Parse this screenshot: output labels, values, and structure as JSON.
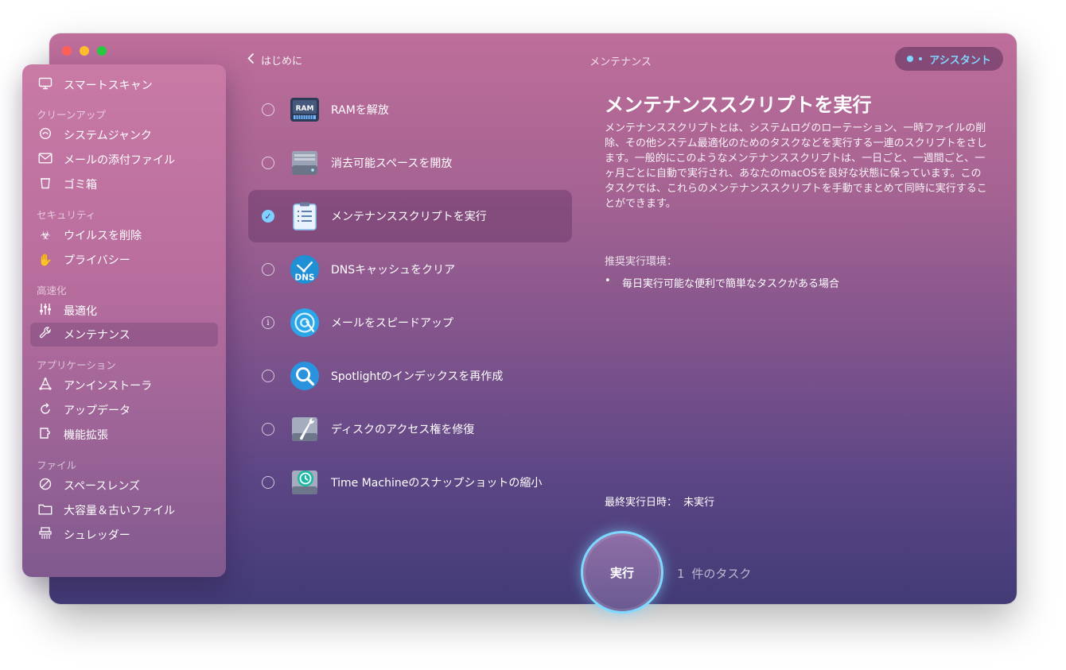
{
  "sidebar": {
    "smart_scan": "スマートスキャン",
    "sections": {
      "cleanup": "クリーンアップ",
      "security": "セキュリティ",
      "speed": "高速化",
      "applications": "アプリケーション",
      "files": "ファイル"
    },
    "items": {
      "system_junk": "システムジャンク",
      "mail_attachments": "メールの添付ファイル",
      "trash": "ゴミ箱",
      "malware": "ウイルスを削除",
      "privacy": "プライバシー",
      "optimization": "最適化",
      "maintenance": "メンテナンス",
      "uninstaller": "アンインストーラ",
      "updater": "アップデータ",
      "extensions": "機能拡張",
      "space_lens": "スペースレンズ",
      "large_old_files": "大容量＆古いファイル",
      "shredder": "シュレッダー"
    }
  },
  "topbar": {
    "back_label": "はじめに",
    "title": "メンテナンス",
    "assistant_label": "アシスタント"
  },
  "tasks": [
    {
      "label": "RAMを解放",
      "state": "unchecked",
      "icon": "ram-icon"
    },
    {
      "label": "消去可能スペースを開放",
      "state": "unchecked",
      "icon": "drive-icon"
    },
    {
      "label": "メンテナンススクリプトを実行",
      "state": "checked",
      "icon": "clipboard-script-icon"
    },
    {
      "label": "DNSキャッシュをクリア",
      "state": "unchecked",
      "icon": "dns-icon"
    },
    {
      "label": "メールをスピードアップ",
      "state": "info",
      "icon": "mail-speed-icon"
    },
    {
      "label": "Spotlightのインデックスを再作成",
      "state": "unchecked",
      "icon": "spotlight-icon"
    },
    {
      "label": "ディスクのアクセス権を修復",
      "state": "unchecked",
      "icon": "disk-repair-icon"
    },
    {
      "label": "Time Machineのスナップショットの縮小",
      "state": "unchecked",
      "icon": "time-machine-icon"
    }
  ],
  "ram_icon_text": "RAM",
  "dns_icon_text": "DNS",
  "detail": {
    "title": "メンテナンススクリプトを実行",
    "description": "メンテナンススクリプトとは、システムログのローテーション、一時ファイルの削除、その他システム最適化のためのタスクなどを実行する一連のスクリプトをさします。一般的にこのようなメンテナンススクリプトは、一日ごと、一週間ごと、一ヶ月ごとに自動で実行され、あなたのmacOSを良好な状態に保っています。このタスクでは、これらのメンテナンススクリプトを手動でまとめて同時に実行することができます。",
    "recommended_label": "推奨実行環境：",
    "recommended_item": "毎日実行可能な便利で簡単なタスクがある場合",
    "last_run_label": "最終実行日時：",
    "last_run_value": "未実行"
  },
  "run": {
    "button_label": "実行",
    "count": "1",
    "count_suffix": "件のタスク"
  },
  "colors": {
    "accent": "#7fd8ff",
    "traffic_red": "#fe5f57",
    "traffic_yellow": "#febc2e",
    "traffic_green": "#28c840"
  }
}
